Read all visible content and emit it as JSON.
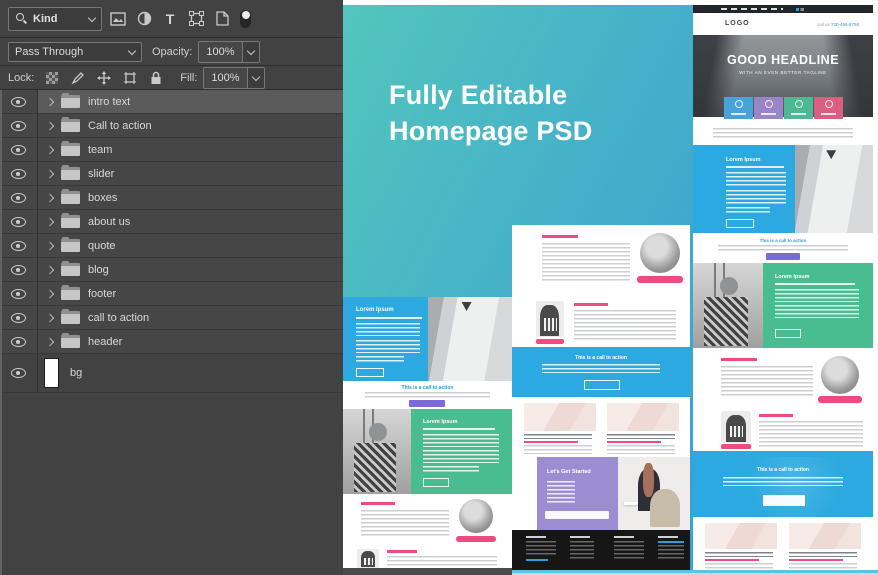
{
  "panel": {
    "search_filter": {
      "label": "Kind"
    },
    "filters": {
      "type_glyph": "T"
    },
    "blend_mode": "Pass Through",
    "opacity": {
      "label": "Opacity:",
      "value": "100%"
    },
    "lock": {
      "label": "Lock:"
    },
    "fill": {
      "label": "Fill:",
      "value": "100%"
    },
    "layers": [
      {
        "name": "intro text",
        "type": "group",
        "selected": true
      },
      {
        "name": "Call to action",
        "type": "group"
      },
      {
        "name": "team",
        "type": "group"
      },
      {
        "name": "slider",
        "type": "group"
      },
      {
        "name": "boxes",
        "type": "group"
      },
      {
        "name": "about us",
        "type": "group"
      },
      {
        "name": "quote",
        "type": "group"
      },
      {
        "name": "blog",
        "type": "group"
      },
      {
        "name": "footer",
        "type": "group"
      },
      {
        "name": "call to action",
        "type": "group"
      },
      {
        "name": "header",
        "type": "group"
      },
      {
        "name": "bg",
        "type": "image"
      }
    ]
  },
  "canvas": {
    "title_line1": "Fully Editable",
    "title_line2": "Homepage PSD",
    "colors": {
      "teal_gradient_start": "#53c6bd",
      "teal_gradient_end": "#3a9ed3",
      "section_blue": "#2ba9e0",
      "section_green": "#49bd90",
      "section_purple": "#9c8dd3",
      "button_purple": "#7b68d9",
      "accent_pink": "#ef4b81",
      "footer_dark": "#161616"
    },
    "mockup": {
      "logo": "LOGO",
      "phone_prefix": "call us",
      "phone": "720-456-8798",
      "hero_title": "GOOD HEADLINE",
      "hero_tagline": "WITH AN EVEN BETTER TAGLINE",
      "panel_heading": "Lorem Ipsum",
      "cta_heading": "This is a call to action",
      "get_started": "Let's Get Started"
    }
  }
}
